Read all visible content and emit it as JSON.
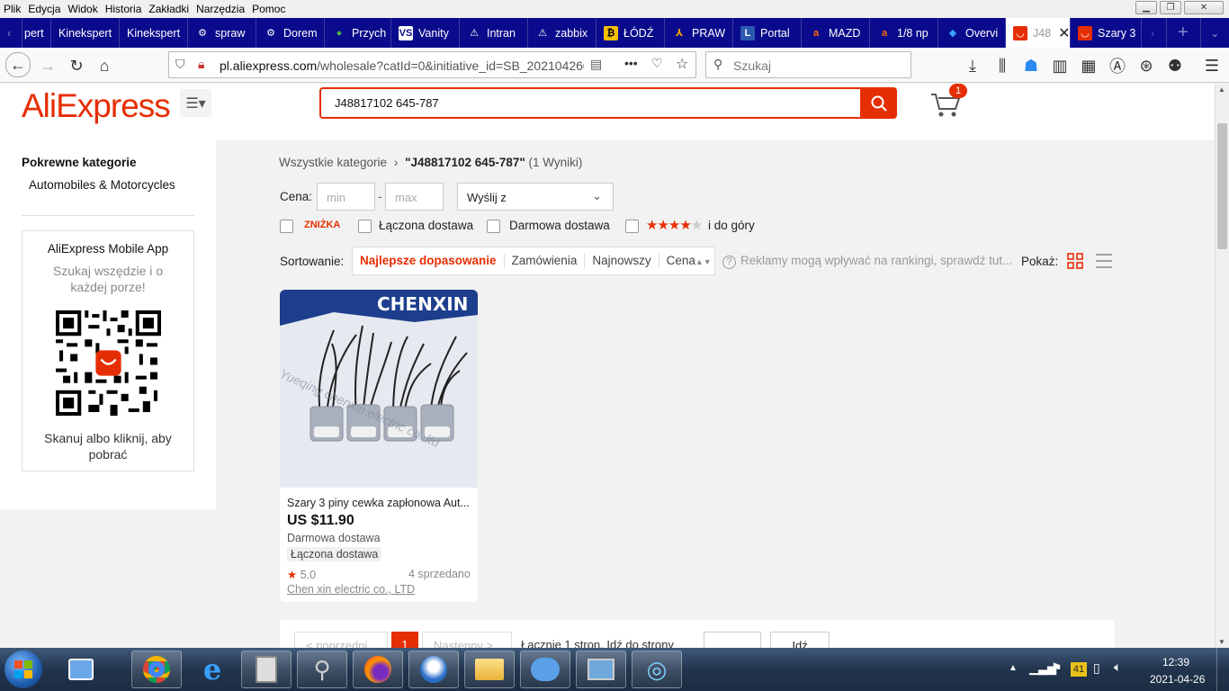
{
  "browser": {
    "menu": [
      "Plik",
      "Edycja",
      "Widok",
      "Historia",
      "Zakładki",
      "Narzędzia",
      "Pomoc"
    ],
    "tabs": [
      {
        "label": "pert",
        "icon": ""
      },
      {
        "label": "Kinekspert",
        "icon": ""
      },
      {
        "label": "Kinekspert",
        "icon": ""
      },
      {
        "label": "spraw",
        "icon": "gear-icon"
      },
      {
        "label": "Dorem",
        "icon": "gear-icon"
      },
      {
        "label": "Przych",
        "icon": "map-pin-icon"
      },
      {
        "label": "Vanity",
        "icon": "vs-icon"
      },
      {
        "label": "Intran",
        "icon": "warning-icon"
      },
      {
        "label": "zabbix",
        "icon": "warning-icon"
      },
      {
        "label": "ŁÓDŹ",
        "icon": "bitcoin-icon"
      },
      {
        "label": "PRAW",
        "icon": "person-icon"
      },
      {
        "label": "Portal",
        "icon": "portal-icon"
      },
      {
        "label": "MAZD",
        "icon": "amazon-icon"
      },
      {
        "label": "1/8 np",
        "icon": "amazon-icon"
      },
      {
        "label": "Overvi",
        "icon": "diamond-icon"
      },
      {
        "label": "J48",
        "icon": "aliexpress-icon"
      },
      {
        "label": "Szary 3",
        "icon": "aliexpress-icon"
      }
    ],
    "url_host": "pl.aliexpress.com",
    "url_path": "/wholesale?catId=0&initiative_id=SB_202104260",
    "search_placeholder": "Szukaj"
  },
  "site": {
    "logo": "AliExpress",
    "search_query": "J48817102 645-787",
    "cart_count": "1"
  },
  "sidebar": {
    "heading": "Pokrewne kategorie",
    "category": "Automobiles & Motorcycles",
    "app_title": "AliExpress Mobile App",
    "app_sub": "Szukaj wszędzie i o każdej porze!",
    "app_cta": "Skanuj albo kliknij, aby pobrać"
  },
  "results": {
    "bc_all": "Wszystkie kategorie",
    "bc_sep": "›",
    "bc_query": "\"J48817102 645-787\"",
    "bc_count": "(1 Wyniki)",
    "price_label": "Cena:",
    "min_ph": "min",
    "dash": "-",
    "max_ph": "max",
    "ship_from": "Wyślij z",
    "f_discount": "ZNIŻKA",
    "f_combined": "Łączona dostawa",
    "f_free": "Darmowa dostawa",
    "f_rating_suffix": "i do góry",
    "sort_label": "Sortowanie:",
    "sort": [
      "Najlepsze dopasowanie",
      "Zamówienia",
      "Najnowszy",
      "Cena"
    ],
    "ads_note": "Reklamy mogą wpływać na rankingi, sprawdź tut...",
    "show_label": "Pokaż:"
  },
  "product": {
    "brand_banner": "CHENXIN",
    "watermark": "Yueqing chenxin electric co.,ltd",
    "title": "Szary 3 piny cewka zapłonowa Aut...",
    "price": "US $11.90",
    "shipping": "Darmowa dostawa",
    "tag": "Łączona dostawa",
    "rating": "5.0",
    "sold": "4 sprzedano",
    "store": "Chen xin electric co., LTD"
  },
  "pager": {
    "prev": "< poprzedni",
    "page": "1",
    "next": "Następny >",
    "info": "Łącznie 1 stron, Idź do strony",
    "go": "Idź"
  },
  "taskbar": {
    "time": "12:39",
    "date": "2021-04-26",
    "badge": "41"
  },
  "colors": {
    "accent": "#e62e04",
    "tabbar": "#0a0a8c"
  }
}
